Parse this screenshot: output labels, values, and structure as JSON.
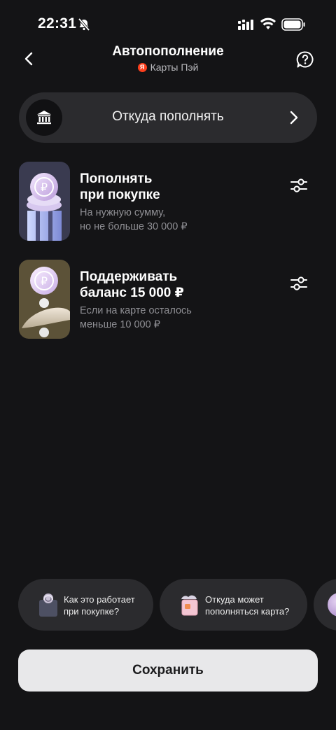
{
  "status_bar": {
    "time": "22:31"
  },
  "header": {
    "title": "Автопополнение",
    "subtitle": "Карты Пэй",
    "brand_letter": "Я"
  },
  "source": {
    "label": "Откуда пополнять"
  },
  "options": [
    {
      "title": "Пополнять\nпри покупке",
      "description": "На нужную сумму,\nно не больше 30 000 ₽"
    },
    {
      "title": "Поддерживать\nбаланс 15 000 ₽",
      "description": "Если на карте осталось\nменьше 10 000 ₽"
    }
  ],
  "chips": [
    {
      "label": "Как это работает\nпри покупке?"
    },
    {
      "label": "Откуда может\nпополняться карта?"
    }
  ],
  "save_label": "Сохранить",
  "colors": {
    "background": "#141416",
    "surface": "#2b2b2e",
    "secondary_text": "#8e8e93",
    "save_button": "#e8e8ea",
    "brand_red": "#fc3f1d"
  }
}
